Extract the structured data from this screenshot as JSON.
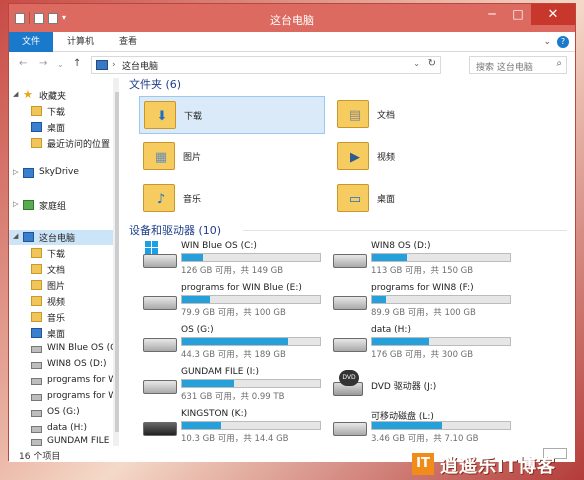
{
  "window": {
    "title": "这台电脑",
    "minimize": "─",
    "maximize": "□",
    "close": "✕"
  },
  "ribbon": {
    "tabs": [
      "文件",
      "计算机",
      "查看"
    ],
    "expand": "⌄",
    "help": "?"
  },
  "address": {
    "back": "←",
    "forward": "→",
    "recent": "⌄",
    "up": "↑",
    "sep": "›",
    "path": "这台电脑",
    "dropdown": "⌄",
    "refresh": "↻"
  },
  "search": {
    "placeholder": "搜索 这台电脑",
    "icon": "search-icon"
  },
  "nav_pane": {
    "favorites_header": "收藏夹",
    "favorites": [
      "下载",
      "桌面",
      "最近访问的位置"
    ],
    "skydrive": "SkyDrive",
    "homegroup": "家庭组",
    "this_pc": "这台电脑",
    "pc_items": [
      "下载",
      "文档",
      "图片",
      "视频",
      "音乐",
      "桌面",
      "WIN Blue OS (C",
      "WIN8 OS (D:)",
      "programs for W",
      "programs for W",
      "OS (G:)",
      "data (H:)",
      "GUNDAM FILE"
    ]
  },
  "content": {
    "folders_header": "文件夹 (6)",
    "folders": [
      {
        "name": "下载",
        "overlay": "download-arrow-icon",
        "glyph": "⬇"
      },
      {
        "name": "文档",
        "overlay": "document-icon",
        "glyph": "▤"
      },
      {
        "name": "图片",
        "overlay": "picture-icon",
        "glyph": "▦"
      },
      {
        "name": "视频",
        "overlay": "video-icon",
        "glyph": "▶"
      },
      {
        "name": "音乐",
        "overlay": "music-icon",
        "glyph": "♪"
      },
      {
        "name": "桌面",
        "overlay": "desktop-icon",
        "glyph": "▭"
      }
    ],
    "drives_header": "设备和驱动器 (10)",
    "drives": [
      {
        "name": "WIN Blue OS (C:)",
        "space": "126 GB 可用，共 149 GB",
        "used_fraction": 0.15,
        "type": "system"
      },
      {
        "name": "WIN8 OS (D:)",
        "space": "113 GB 可用，共 150 GB",
        "used_fraction": 0.25,
        "type": "hdd"
      },
      {
        "name": "programs for WIN Blue (E:)",
        "space": "79.9 GB 可用，共 100 GB",
        "used_fraction": 0.2,
        "type": "hdd"
      },
      {
        "name": "programs for WIN8 (F:)",
        "space": "89.9 GB 可用，共 100 GB",
        "used_fraction": 0.1,
        "type": "hdd"
      },
      {
        "name": "OS (G:)",
        "space": "44.3 GB 可用，共 189 GB",
        "used_fraction": 0.77,
        "type": "hdd"
      },
      {
        "name": "data (H:)",
        "space": "176 GB 可用，共 300 GB",
        "used_fraction": 0.41,
        "type": "hdd"
      },
      {
        "name": "GUNDAM FILE (I:)",
        "space": "631 GB 可用，共 0.99 TB",
        "used_fraction": 0.38,
        "type": "hdd"
      },
      {
        "name": "DVD 驱动器 (J:)",
        "space": "",
        "used_fraction": null,
        "type": "dvd"
      },
      {
        "name": "KINGSTON (K:)",
        "space": "10.3 GB 可用，共 14.4 GB",
        "used_fraction": 0.28,
        "type": "usb"
      },
      {
        "name": "可移动磁盘 (L:)",
        "space": "3.46 GB 可用，共 7.10 GB",
        "used_fraction": 0.51,
        "type": "usb"
      }
    ]
  },
  "status": {
    "count": "16 个项目"
  },
  "watermark": {
    "logo": "IT",
    "text": "逍遥乐IT博客"
  },
  "colors": {
    "accent": "#1979ca",
    "title_bar": "#dd6a60",
    "close": "#c7372b",
    "bar_fill": "#26a0da"
  }
}
